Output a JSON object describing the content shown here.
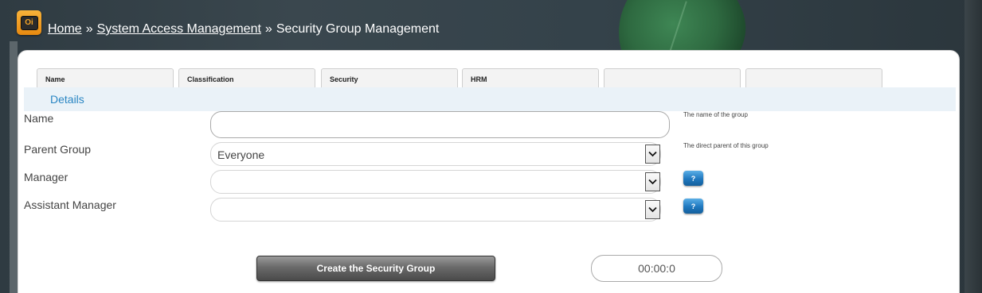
{
  "breadcrumb": {
    "home": "Home",
    "separator_1": "»",
    "system_access": "System Access Management",
    "separator_2": "»",
    "current": "Security Group Management"
  },
  "logo": {
    "text": "Oi"
  },
  "tabs": [
    {
      "label": "Name"
    },
    {
      "label": "Classification"
    },
    {
      "label": "Security"
    },
    {
      "label": "HRM"
    },
    {
      "label": ""
    },
    {
      "label": ""
    }
  ],
  "details": {
    "title": "Details"
  },
  "form": {
    "name": {
      "label": "Name",
      "value": "",
      "hint": "The name of the group"
    },
    "parent_group": {
      "label": "Parent Group",
      "value": "Everyone",
      "hint": "The direct parent of this group"
    },
    "manager": {
      "label": "Manager",
      "value": "",
      "help": "?"
    },
    "assistant_manager": {
      "label": "Assistant Manager",
      "value": "",
      "help": "?"
    }
  },
  "actions": {
    "create_label": "Create the Security Group",
    "timer": "00:00:0"
  },
  "colors": {
    "accent": "#2a86c3",
    "details_bar": "#eaf2f8",
    "logo": "#f4a326"
  },
  "icons": {
    "logo": "app-logo-icon",
    "dropdown": "chevron-down-icon",
    "help": "help-icon"
  }
}
